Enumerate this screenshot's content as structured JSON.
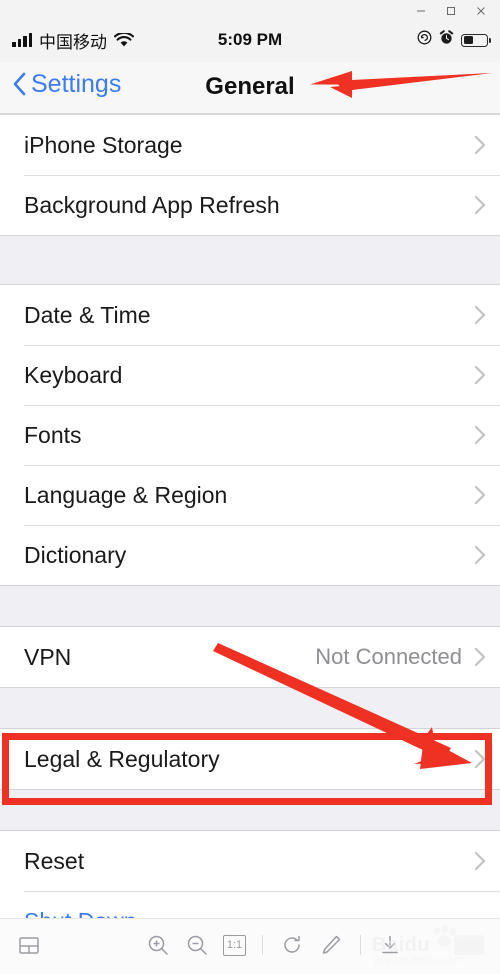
{
  "window": {
    "minimize_label": "Minimize",
    "maximize_label": "Maximize",
    "close_label": "Close"
  },
  "status_bar": {
    "carrier": "中国移动",
    "time": "5:09 PM",
    "signal_icon": "signal-bars-icon",
    "wifi_icon": "wifi-icon",
    "rotation_lock_icon": "rotation-lock-icon",
    "alarm_icon": "alarm-clock-icon",
    "battery_icon": "battery-icon"
  },
  "nav_bar": {
    "back_label": "Settings",
    "title": "General"
  },
  "sections": [
    {
      "id": "storage",
      "rows": [
        {
          "label": "iPhone Storage",
          "value": "",
          "accessory": "chevron"
        },
        {
          "label": "Background App Refresh",
          "value": "",
          "accessory": "chevron"
        }
      ]
    },
    {
      "id": "localization",
      "rows": [
        {
          "label": "Date & Time",
          "value": "",
          "accessory": "chevron"
        },
        {
          "label": "Keyboard",
          "value": "",
          "accessory": "chevron"
        },
        {
          "label": "Fonts",
          "value": "",
          "accessory": "chevron"
        },
        {
          "label": "Language & Region",
          "value": "",
          "accessory": "chevron"
        },
        {
          "label": "Dictionary",
          "value": "",
          "accessory": "chevron"
        }
      ]
    },
    {
      "id": "vpn",
      "rows": [
        {
          "label": "VPN",
          "value": "Not Connected",
          "accessory": "chevron"
        }
      ]
    },
    {
      "id": "legal",
      "rows": [
        {
          "label": "Legal & Regulatory",
          "value": "",
          "accessory": "chevron"
        }
      ]
    },
    {
      "id": "reset",
      "rows": [
        {
          "label": "Reset",
          "value": "",
          "accessory": "chevron"
        },
        {
          "label": "Shut Down",
          "value": "",
          "accessory": "none",
          "style": "blue"
        }
      ]
    }
  ],
  "annotations": {
    "highlight_color": "#ef3124",
    "arrow_color": "#ef3124",
    "title_arrow_name": "arrow-pointing-to-general-title",
    "row_arrow_name": "arrow-pointing-to-legal-regulatory",
    "highlight_name": "highlight-box-legal-regulatory"
  },
  "toolbar": {
    "layout_icon": "screen-layout-icon",
    "zoom_in_icon": "zoom-in-icon",
    "zoom_out_icon": "zoom-out-icon",
    "actual_size_label": "1:1",
    "rotate_icon": "rotate-icon",
    "edit_icon": "pencil-edit-icon",
    "download_icon": "download-icon"
  },
  "watermark": {
    "brand": "Baidu",
    "badge": "经验",
    "sub": "jingyan.baidu.com",
    "paw_icon": "paw-print-icon"
  }
}
